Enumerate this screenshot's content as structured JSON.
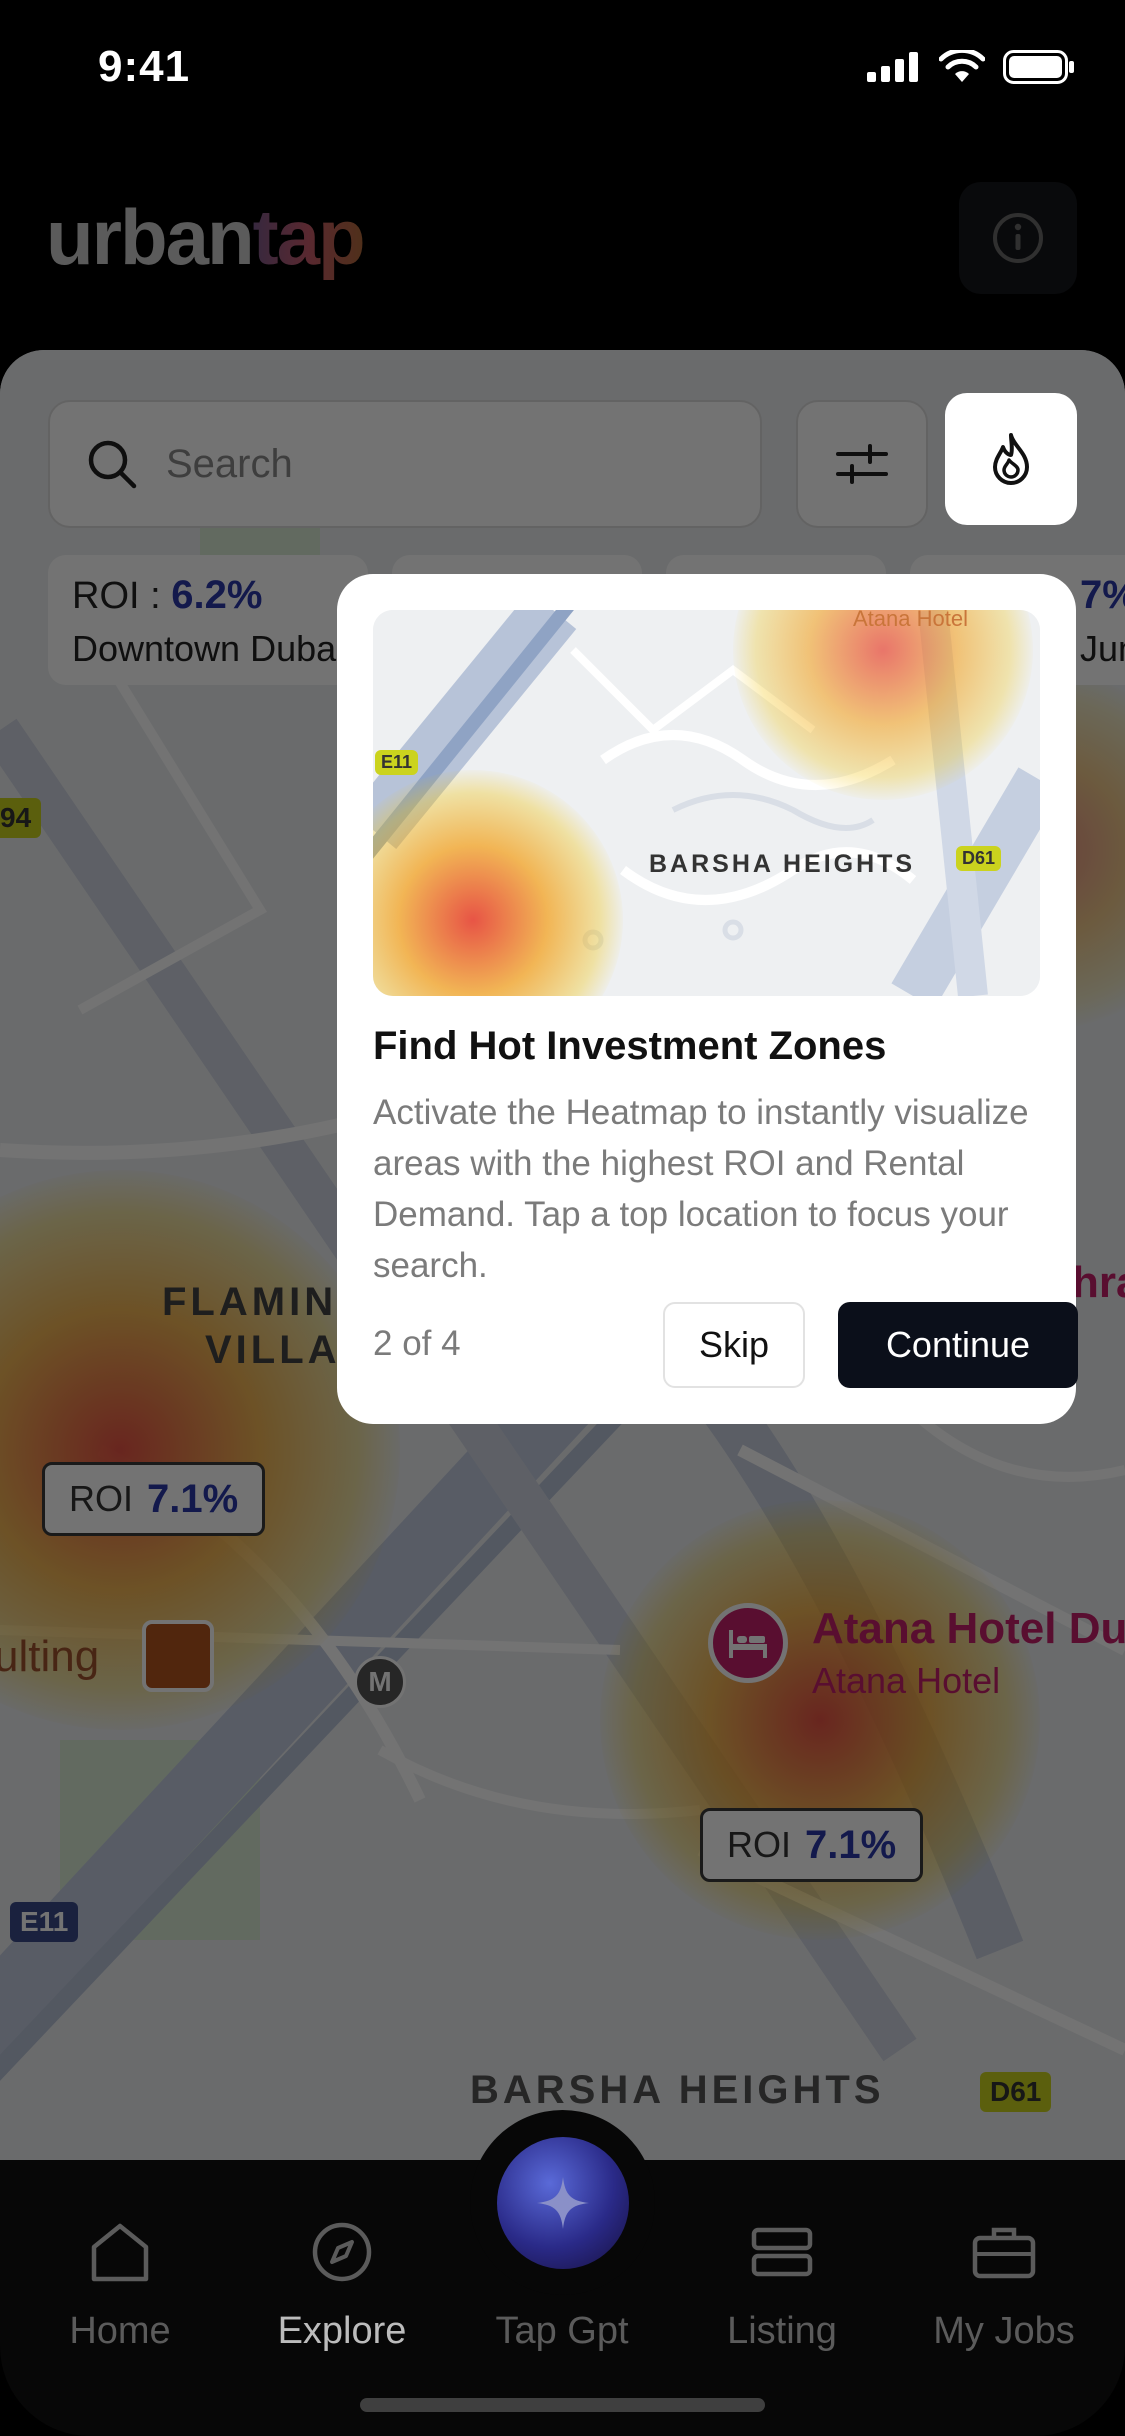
{
  "status_bar": {
    "time": "9:41"
  },
  "header": {
    "logo_left": "urban",
    "logo_right": "tap"
  },
  "search": {
    "placeholder": "Search"
  },
  "roi_cards": [
    {
      "roi_label": "ROI : ",
      "roi_value": "6.2%",
      "place": "Downtown Dubai"
    },
    {
      "roi_label": "",
      "roi_value": "7%",
      "place": "Jumei"
    }
  ],
  "map": {
    "labels": [
      "FLAMINGO",
      "VILLAS",
      "BARSHA HEIGHTS"
    ],
    "badges": [
      {
        "label": "ROI",
        "value": "7.1%"
      },
      {
        "label": "ROI",
        "value": "7.1%"
      }
    ],
    "hotel": {
      "name": "Atana Hotel Dubai",
      "sub": "Atana Hotel"
    },
    "poi": "ulting",
    "road_shields": [
      "E11",
      "D61",
      "94",
      "M"
    ],
    "arabic_fragment": "hra"
  },
  "modal": {
    "image_labels": {
      "area": "BARSHA HEIGHTS",
      "hotel": "Atana Hotel",
      "e11": "E11",
      "d61": "D61"
    },
    "title": "Find Hot Investment Zones",
    "description": "Activate the Heatmap to instantly visualize areas with the highest ROI and Rental Demand. Tap a top location to focus your search.",
    "step": "2 of 4",
    "skip_label": "Skip",
    "continue_label": "Continue"
  },
  "tabs": [
    {
      "label": "Home",
      "icon": "home-icon"
    },
    {
      "label": "Explore",
      "icon": "compass-icon"
    },
    {
      "label": "Tap Gpt",
      "icon": "sparkle-icon"
    },
    {
      "label": "Listing",
      "icon": "listing-icon"
    },
    {
      "label": "My Jobs",
      "icon": "briefcase-icon"
    }
  ],
  "colors": {
    "accent_blue": "#2a39a8",
    "hotel_pink": "#c6206b",
    "continue_bg": "#0b0f1a"
  }
}
